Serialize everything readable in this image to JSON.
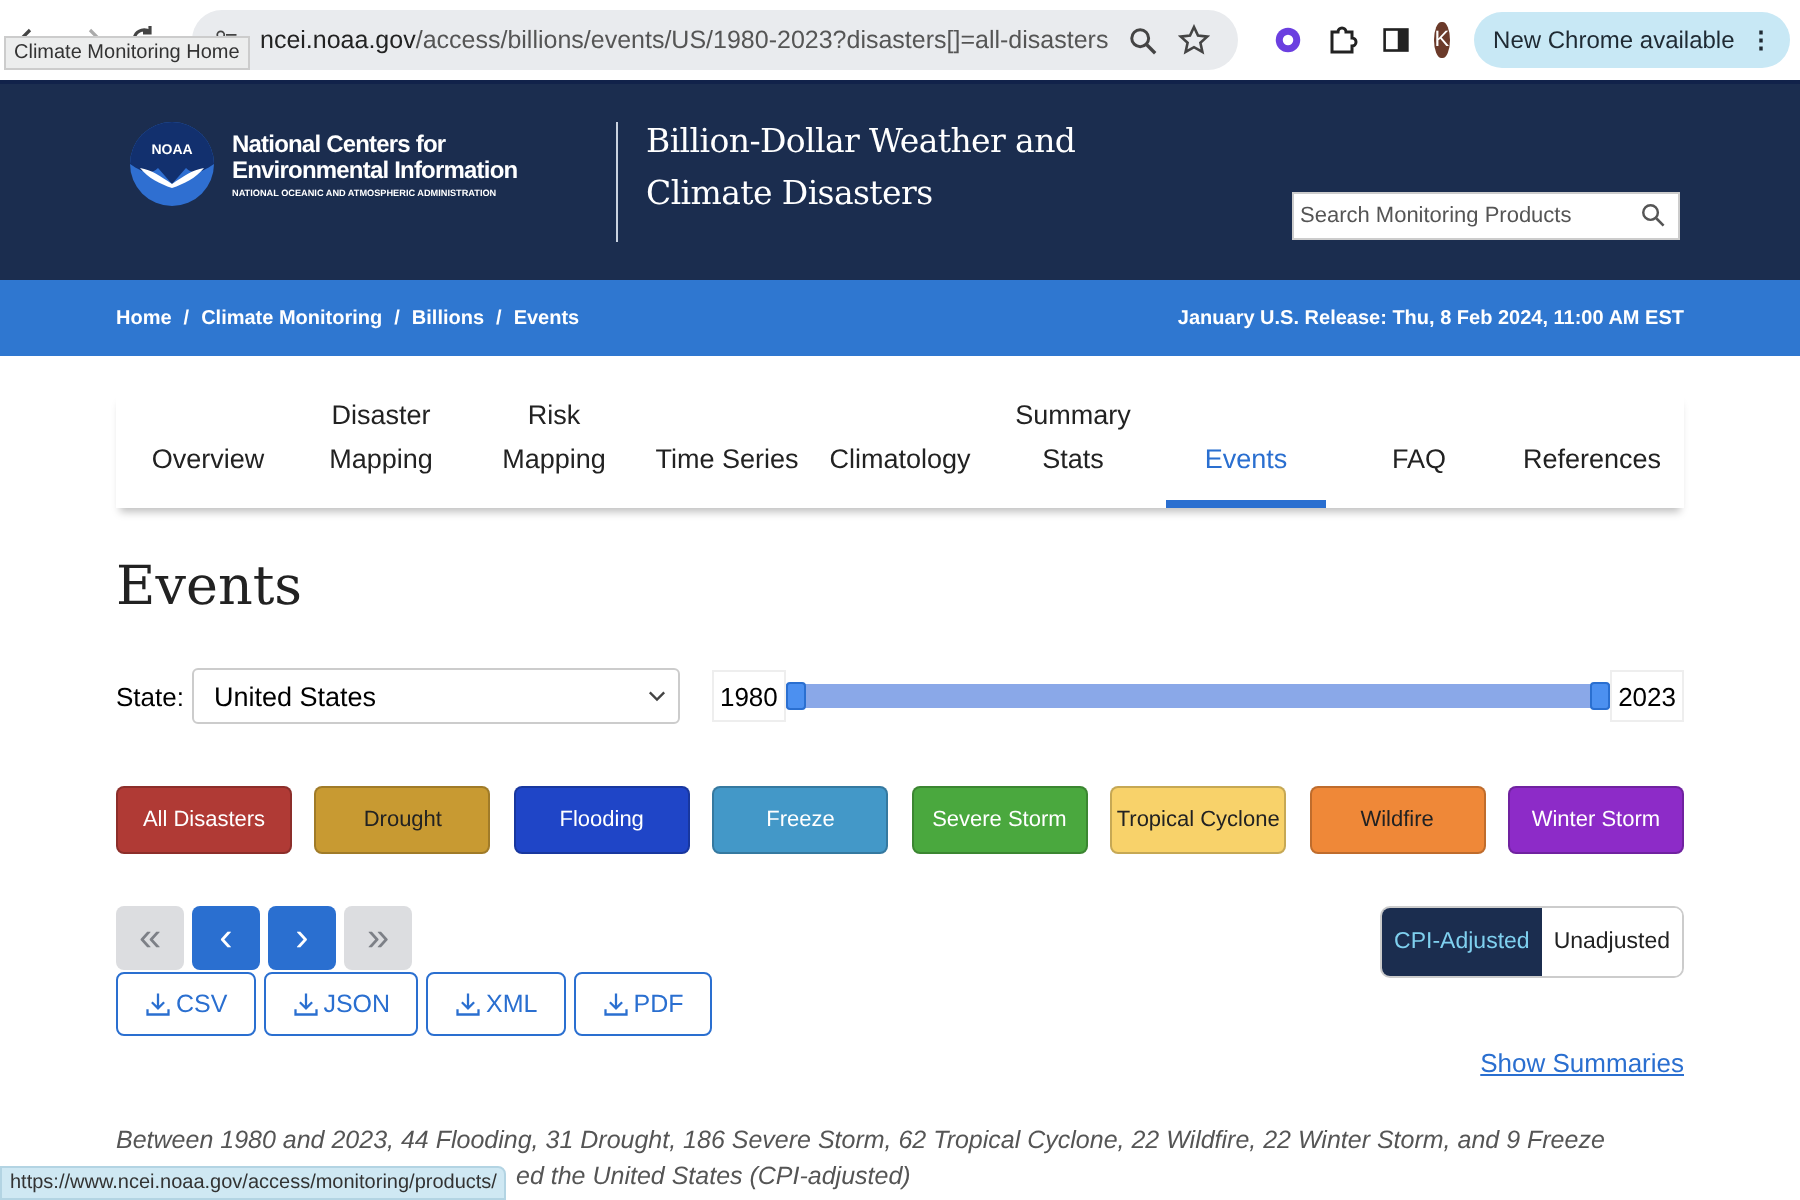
{
  "browser": {
    "url_host": "ncei.noaa.gov",
    "url_path": "/access/billions/events/US/1980-2023?disasters[]=all-disasters",
    "tooltip": "Climate Monitoring Home",
    "avatar": "K",
    "update_button": "New Chrome available",
    "menu_glyph": "⋮",
    "status_url": "https://www.ncei.noaa.gov/access/monitoring/products/"
  },
  "header": {
    "org_name": "National Centers for Environmental Information",
    "org_sub": "NATIONAL OCEANIC AND ATMOSPHERIC ADMINISTRATION",
    "logo_text": "NOAA",
    "title_lines": [
      "Billion-Dollar Weather and",
      "Climate Disasters"
    ],
    "search": {
      "placeholder": "Search Monitoring Products"
    }
  },
  "breadcrumbs": [
    "Home",
    "Climate Monitoring",
    "Billions",
    "Events"
  ],
  "breadcrumb_separator": "/",
  "release": "January U.S. Release: Thu, 8 Feb 2024, 11:00 AM EST",
  "tabs": [
    {
      "label": "Overview",
      "selected": false
    },
    {
      "label": "Disaster Mapping",
      "selected": false
    },
    {
      "label": "Risk Mapping",
      "selected": false
    },
    {
      "label": "Time Series",
      "selected": false
    },
    {
      "label": "Climatology",
      "selected": false
    },
    {
      "label": "Summary Stats",
      "selected": false
    },
    {
      "label": "Events",
      "selected": true
    },
    {
      "label": "FAQ",
      "selected": false
    },
    {
      "label": "References",
      "selected": false
    }
  ],
  "heading": "Events",
  "state": {
    "label": "State:",
    "value": "United States"
  },
  "year_range": {
    "start": "1980",
    "end": "2023",
    "handles": [
      {
        "level": 0
      },
      {
        "level": 1
      }
    ]
  },
  "disasters": [
    {
      "label": "All Disasters",
      "color": "#b03a35"
    },
    {
      "label": "Drought",
      "color": "#c89a32"
    },
    {
      "label": "Flooding",
      "color": "#1f45c7"
    },
    {
      "label": "Freeze",
      "color": "#4398c8"
    },
    {
      "label": "Severe Storm",
      "color": "#4aa83e"
    },
    {
      "label": "Tropical Cyclone",
      "color": "#f8d26a"
    },
    {
      "label": "Wildfire",
      "color": "#ef8838"
    },
    {
      "label": "Winter Storm",
      "color": "#8d2bc8"
    }
  ],
  "pager": [
    {
      "label": "«",
      "disabled": true
    },
    {
      "label": "‹",
      "disabled": false
    },
    {
      "label": "›",
      "disabled": false
    },
    {
      "label": "»",
      "disabled": true
    }
  ],
  "downloads": [
    "CSV",
    "JSON",
    "XML",
    "PDF"
  ],
  "adjust": [
    {
      "label": "CPI-Adjusted",
      "selected": true
    },
    {
      "label": "Unadjusted",
      "selected": false
    }
  ],
  "summaries_link": "Show Summaries",
  "summary_lines": [
    "Between 1980 and 2023, 44 Flooding, 31 Drought, 186 Severe Storm, 62 Tropical Cyclone, 22 Wildfire, 22 Winter Storm, and 9 Freeze",
    "ed the United States (CPI-adjusted)"
  ]
}
